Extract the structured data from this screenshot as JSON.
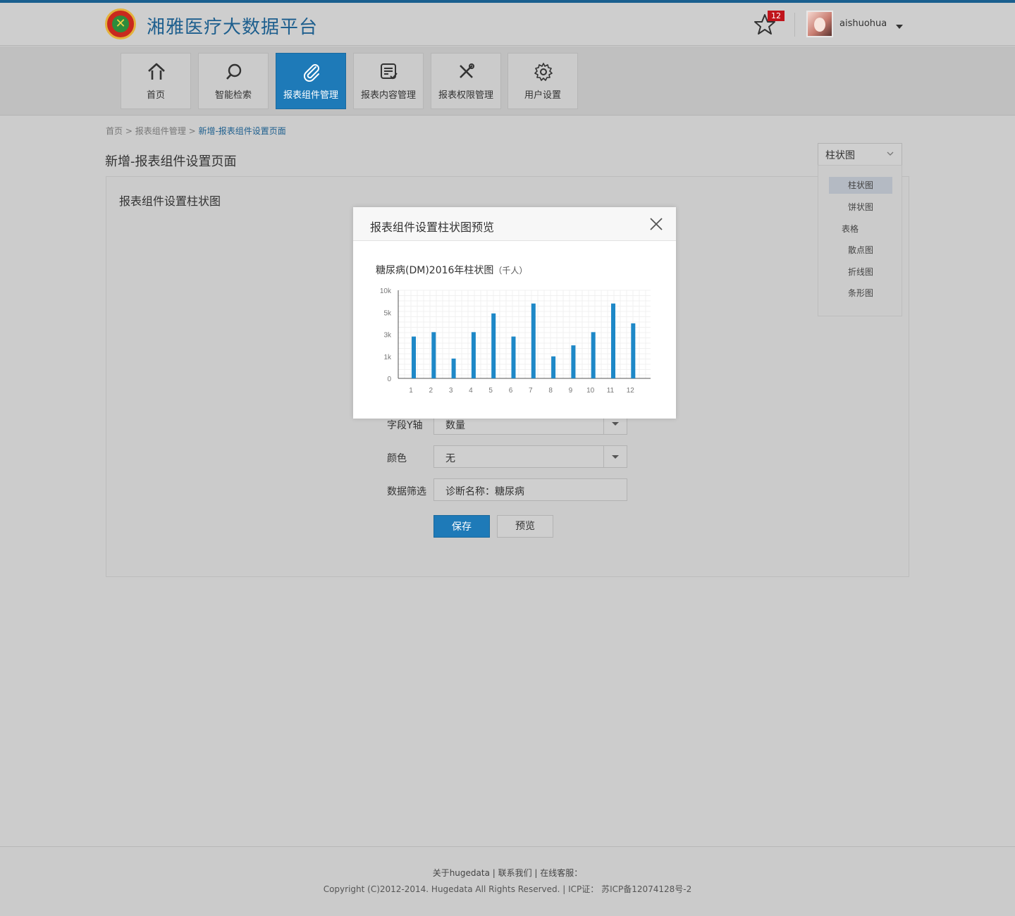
{
  "header": {
    "app_title": "湘雅医疗大数据平台",
    "notification_count": "12",
    "username": "aishuohua"
  },
  "nav": [
    {
      "label": "首页",
      "icon": "home-icon"
    },
    {
      "label": "智能检索",
      "icon": "search-icon"
    },
    {
      "label": "报表组件管理",
      "icon": "paperclip-icon",
      "active": true
    },
    {
      "label": "报表内容管理",
      "icon": "report-icon"
    },
    {
      "label": "报表权限管理",
      "icon": "tools-icon"
    },
    {
      "label": "用户设置",
      "icon": "gear-icon"
    }
  ],
  "breadcrumb": {
    "home": "首页",
    "sep1": ">",
    "section": "报表组件管理",
    "sep2": ">",
    "current": "新增-报表组件设置页面"
  },
  "page_title": "新增-报表组件设置页面",
  "panel_title": "报表组件设置柱状图",
  "form": {
    "y_axis_label": "字段Y轴",
    "y_axis_value": "数量",
    "color_label": "颜色",
    "color_value": "无",
    "filter_label": "数据筛选",
    "filter_value": "诊断名称：糖尿病",
    "save_label": "保存",
    "preview_label": "预览"
  },
  "chart_type_select": {
    "selected": "柱状图",
    "options": [
      "柱状图",
      "饼状图",
      "表格",
      "散点图",
      "折线图",
      "条形图"
    ]
  },
  "modal": {
    "title": "报表组件设置柱状图预览",
    "chart_title": "糖尿病(DM)2016年柱状图",
    "chart_unit": "（千人）"
  },
  "chart_data": {
    "type": "bar",
    "title": "糖尿病(DM)2016年柱状图（千人）",
    "categories": [
      "1",
      "2",
      "3",
      "4",
      "5",
      "6",
      "7",
      "8",
      "9",
      "10",
      "11",
      "12"
    ],
    "values": [
      2.8,
      3.2,
      0.9,
      3.2,
      4.9,
      2.8,
      7.0,
      1.0,
      2.0,
      3.2,
      7.0,
      4.0
    ],
    "y_ticks": [
      "0",
      "1k",
      "3k",
      "5k",
      "10k"
    ],
    "y_tick_levels": [
      0,
      1,
      3,
      5,
      10
    ],
    "color": "#1e88c7",
    "grid": true
  },
  "footer": {
    "links": "关于hugedata  |   联系我们  |   在线客服：",
    "copyright": "Copyright (C)2012-2014. Hugedata All Rights Reserved. | ICP证： 苏ICP备12074128号-2"
  },
  "colors": {
    "brand": "#1e5f8e",
    "accent": "#1e7ab8",
    "badge": "#c0141b"
  }
}
